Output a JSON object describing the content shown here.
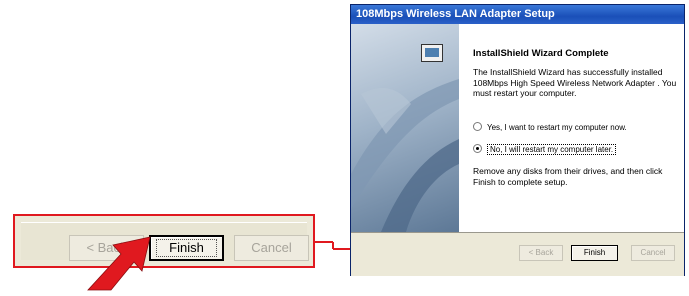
{
  "colors": {
    "highlight_red": "#e0191f",
    "titlebar_blue": "#1a4fb8",
    "dialog_face": "#ece9d8"
  },
  "zoom": {
    "back_label": "< Back",
    "finish_label": "Finish",
    "cancel_label": "Cancel"
  },
  "dialog": {
    "title": "108Mbps Wireless LAN Adapter Setup",
    "icon": "setup-computer-icon",
    "heading": "InstallShield Wizard Complete",
    "message": "The InstallShield Wizard has successfully installed 108Mbps High Speed Wireless Network Adapter . You must restart your computer.",
    "radio_options": [
      {
        "label": "Yes, I want to restart my computer now.",
        "selected": false
      },
      {
        "label": "No, I will restart my computer later.",
        "selected": true
      }
    ],
    "note": "Remove any disks from their drives, and then click Finish to complete setup.",
    "buttons": {
      "back": "< Back",
      "finish": "Finish",
      "cancel": "Cancel"
    }
  }
}
